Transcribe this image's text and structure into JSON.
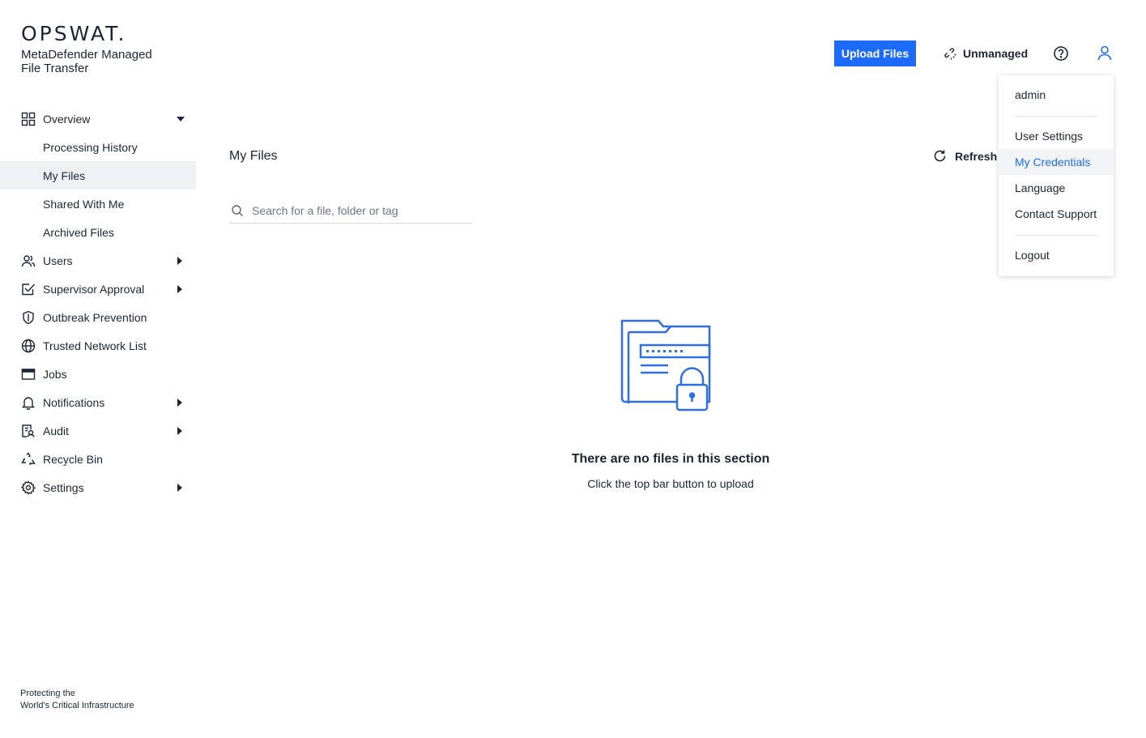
{
  "brand": {
    "logo": "OPSWAT.",
    "product_line1": "MetaDefender Managed",
    "product_line2": "File Transfer",
    "footer_line1": "Protecting the",
    "footer_line2": "World's Critical Infrastructure"
  },
  "sidebar": {
    "items": [
      {
        "label": "Overview",
        "icon": "grid-icon"
      },
      {
        "label": "Processing History"
      },
      {
        "label": "My Files"
      },
      {
        "label": "Shared With Me"
      },
      {
        "label": "Archived Files"
      },
      {
        "label": "Users",
        "icon": "users-icon"
      },
      {
        "label": "Supervisor Approval",
        "icon": "approval-icon"
      },
      {
        "label": "Outbreak Prevention",
        "icon": "shield-icon"
      },
      {
        "label": "Trusted Network List",
        "icon": "globe-icon"
      },
      {
        "label": "Jobs",
        "icon": "window-icon"
      },
      {
        "label": "Notifications",
        "icon": "bell-icon"
      },
      {
        "label": "Audit",
        "icon": "audit-icon"
      },
      {
        "label": "Recycle Bin",
        "icon": "recycle-icon"
      },
      {
        "label": "Settings",
        "icon": "gear-icon"
      }
    ]
  },
  "topbar": {
    "upload_label": "Upload Files",
    "unmanaged_label": "Unmanaged"
  },
  "main": {
    "title": "My Files",
    "refresh_label": "Refresh",
    "search_placeholder": "Search for a file, folder or tag",
    "empty_title": "There are no files in this section",
    "empty_subtitle": "Click the top bar button to upload"
  },
  "user_menu": {
    "username": "admin",
    "items": [
      "User Settings",
      "My Credentials",
      "Language",
      "Contact Support"
    ],
    "logout": "Logout"
  },
  "colors": {
    "accent": "#1d6bfc",
    "text": "#1b2537",
    "active_bg": "#eef0f4"
  }
}
